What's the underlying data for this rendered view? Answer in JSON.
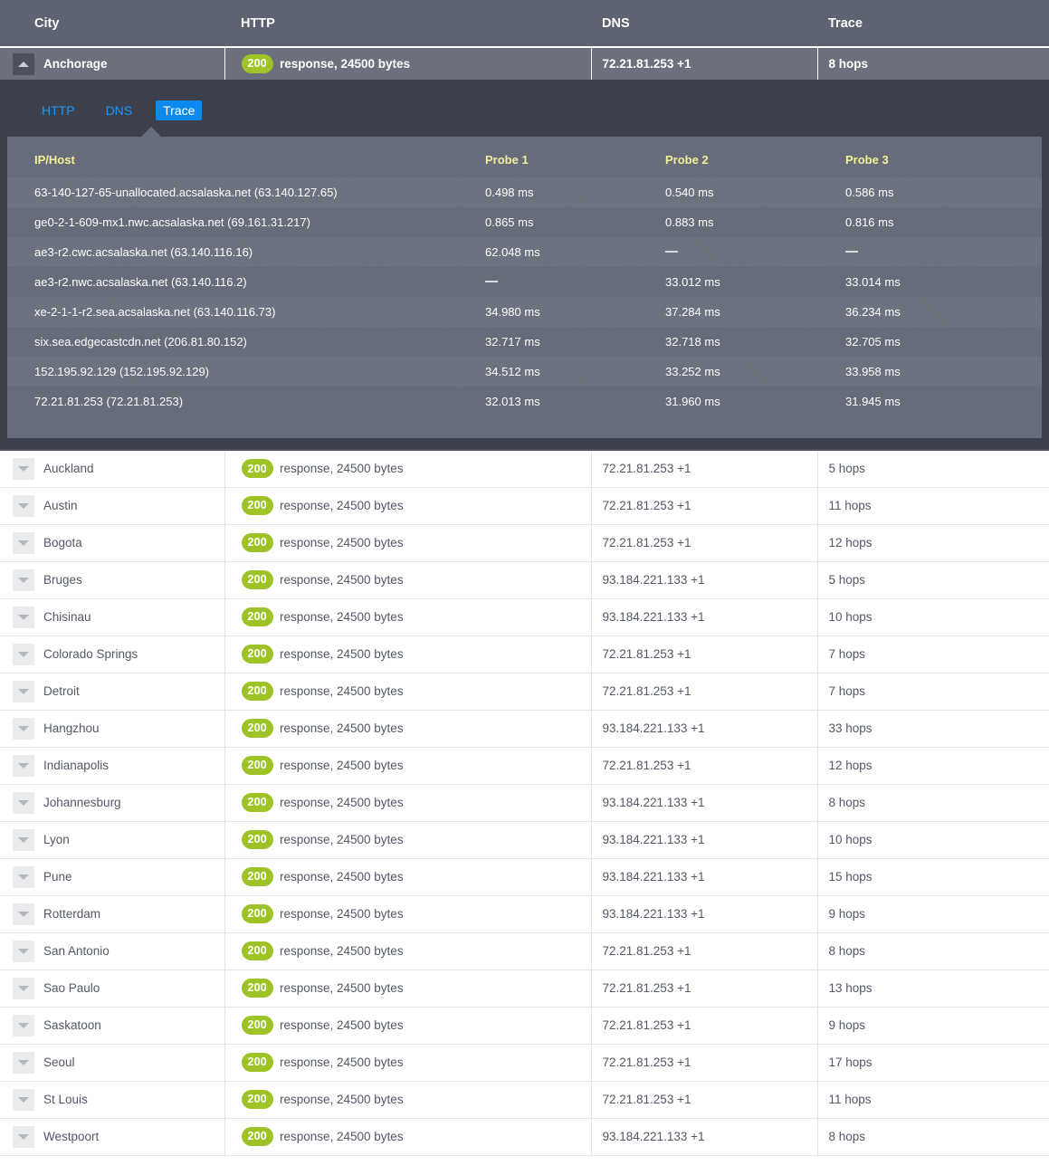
{
  "table": {
    "columns": [
      "City",
      "HTTP",
      "DNS",
      "Trace"
    ],
    "expanded_row": {
      "city": "Anchorage",
      "http": {
        "status": "200",
        "text": "response, 24500 bytes"
      },
      "dns": "72.21.81.253 +1",
      "trace": "8 hops",
      "toggle_icon": "caret-up-icon",
      "tabs": [
        {
          "label": "HTTP",
          "active": false
        },
        {
          "label": "DNS",
          "active": false
        },
        {
          "label": "Trace",
          "active": true
        }
      ],
      "trace_detail": {
        "columns": [
          "IP/Host",
          "Probe 1",
          "Probe 2",
          "Probe 3"
        ],
        "hops": [
          {
            "host": "63-140-127-65-unallocated.acsalaska.net (63.140.127.65)",
            "p1": "0.498 ms",
            "p2": "0.540 ms",
            "p3": "0.586 ms"
          },
          {
            "host": "ge0-2-1-609-mx1.nwc.acsalaska.net (69.161.31.217)",
            "p1": "0.865 ms",
            "p2": "0.883 ms",
            "p3": "0.816 ms"
          },
          {
            "host": "ae3-r2.cwc.acsalaska.net (63.140.116.16)",
            "p1": "62.048 ms",
            "p2": "—",
            "p3": "—"
          },
          {
            "host": "ae3-r2.nwc.acsalaska.net (63.140.116.2)",
            "p1": "—",
            "p2": "33.012 ms",
            "p3": "33.014 ms"
          },
          {
            "host": "xe-2-1-1-r2.sea.acsalaska.net (63.140.116.73)",
            "p1": "34.980 ms",
            "p2": "37.284 ms",
            "p3": "36.234 ms"
          },
          {
            "host": "six.sea.edgecastcdn.net (206.81.80.152)",
            "p1": "32.717 ms",
            "p2": "32.718 ms",
            "p3": "32.705 ms"
          },
          {
            "host": "152.195.92.129 (152.195.92.129)",
            "p1": "34.512 ms",
            "p2": "33.252 ms",
            "p3": "33.958 ms"
          },
          {
            "host": "72.21.81.253 (72.21.81.253)",
            "p1": "32.013 ms",
            "p2": "31.960 ms",
            "p3": "31.945 ms"
          }
        ]
      }
    },
    "rows": [
      {
        "city": "Auckland",
        "status": "200",
        "http": "response, 24500 bytes",
        "dns": "72.21.81.253 +1",
        "trace": "5 hops"
      },
      {
        "city": "Austin",
        "status": "200",
        "http": "response, 24500 bytes",
        "dns": "72.21.81.253 +1",
        "trace": "11 hops"
      },
      {
        "city": "Bogota",
        "status": "200",
        "http": "response, 24500 bytes",
        "dns": "72.21.81.253 +1",
        "trace": "12 hops"
      },
      {
        "city": "Bruges",
        "status": "200",
        "http": "response, 24500 bytes",
        "dns": "93.184.221.133 +1",
        "trace": "5 hops"
      },
      {
        "city": "Chisinau",
        "status": "200",
        "http": "response, 24500 bytes",
        "dns": "93.184.221.133 +1",
        "trace": "10 hops"
      },
      {
        "city": "Colorado Springs",
        "status": "200",
        "http": "response, 24500 bytes",
        "dns": "72.21.81.253 +1",
        "trace": "7 hops"
      },
      {
        "city": "Detroit",
        "status": "200",
        "http": "response, 24500 bytes",
        "dns": "72.21.81.253 +1",
        "trace": "7 hops"
      },
      {
        "city": "Hangzhou",
        "status": "200",
        "http": "response, 24500 bytes",
        "dns": "93.184.221.133 +1",
        "trace": "33 hops"
      },
      {
        "city": "Indianapolis",
        "status": "200",
        "http": "response, 24500 bytes",
        "dns": "72.21.81.253 +1",
        "trace": "12 hops"
      },
      {
        "city": "Johannesburg",
        "status": "200",
        "http": "response, 24500 bytes",
        "dns": "93.184.221.133 +1",
        "trace": "8 hops"
      },
      {
        "city": "Lyon",
        "status": "200",
        "http": "response, 24500 bytes",
        "dns": "93.184.221.133 +1",
        "trace": "10 hops"
      },
      {
        "city": "Pune",
        "status": "200",
        "http": "response, 24500 bytes",
        "dns": "93.184.221.133 +1",
        "trace": "15 hops"
      },
      {
        "city": "Rotterdam",
        "status": "200",
        "http": "response, 24500 bytes",
        "dns": "93.184.221.133 +1",
        "trace": "9 hops"
      },
      {
        "city": "San Antonio",
        "status": "200",
        "http": "response, 24500 bytes",
        "dns": "72.21.81.253 +1",
        "trace": "8 hops"
      },
      {
        "city": "Sao Paulo",
        "status": "200",
        "http": "response, 24500 bytes",
        "dns": "72.21.81.253 +1",
        "trace": "13 hops"
      },
      {
        "city": "Saskatoon",
        "status": "200",
        "http": "response, 24500 bytes",
        "dns": "72.21.81.253 +1",
        "trace": "9 hops"
      },
      {
        "city": "Seoul",
        "status": "200",
        "http": "response, 24500 bytes",
        "dns": "72.21.81.253 +1",
        "trace": "17 hops"
      },
      {
        "city": "St Louis",
        "status": "200",
        "http": "response, 24500 bytes",
        "dns": "72.21.81.253 +1",
        "trace": "11 hops"
      },
      {
        "city": "Westpoort",
        "status": "200",
        "http": "response, 24500 bytes",
        "dns": "93.184.221.133 +1",
        "trace": "8 hops"
      }
    ]
  },
  "colors": {
    "header_bg": "#5d6370",
    "open_row_bg": "#6b707c",
    "panel_bg": "#3b404c",
    "trace_bg": "#666c79",
    "status_badge": "#9ec326",
    "tab_active": "#0d8aee",
    "tab_link": "#2196f3",
    "probe_header": "#f2f09a"
  }
}
